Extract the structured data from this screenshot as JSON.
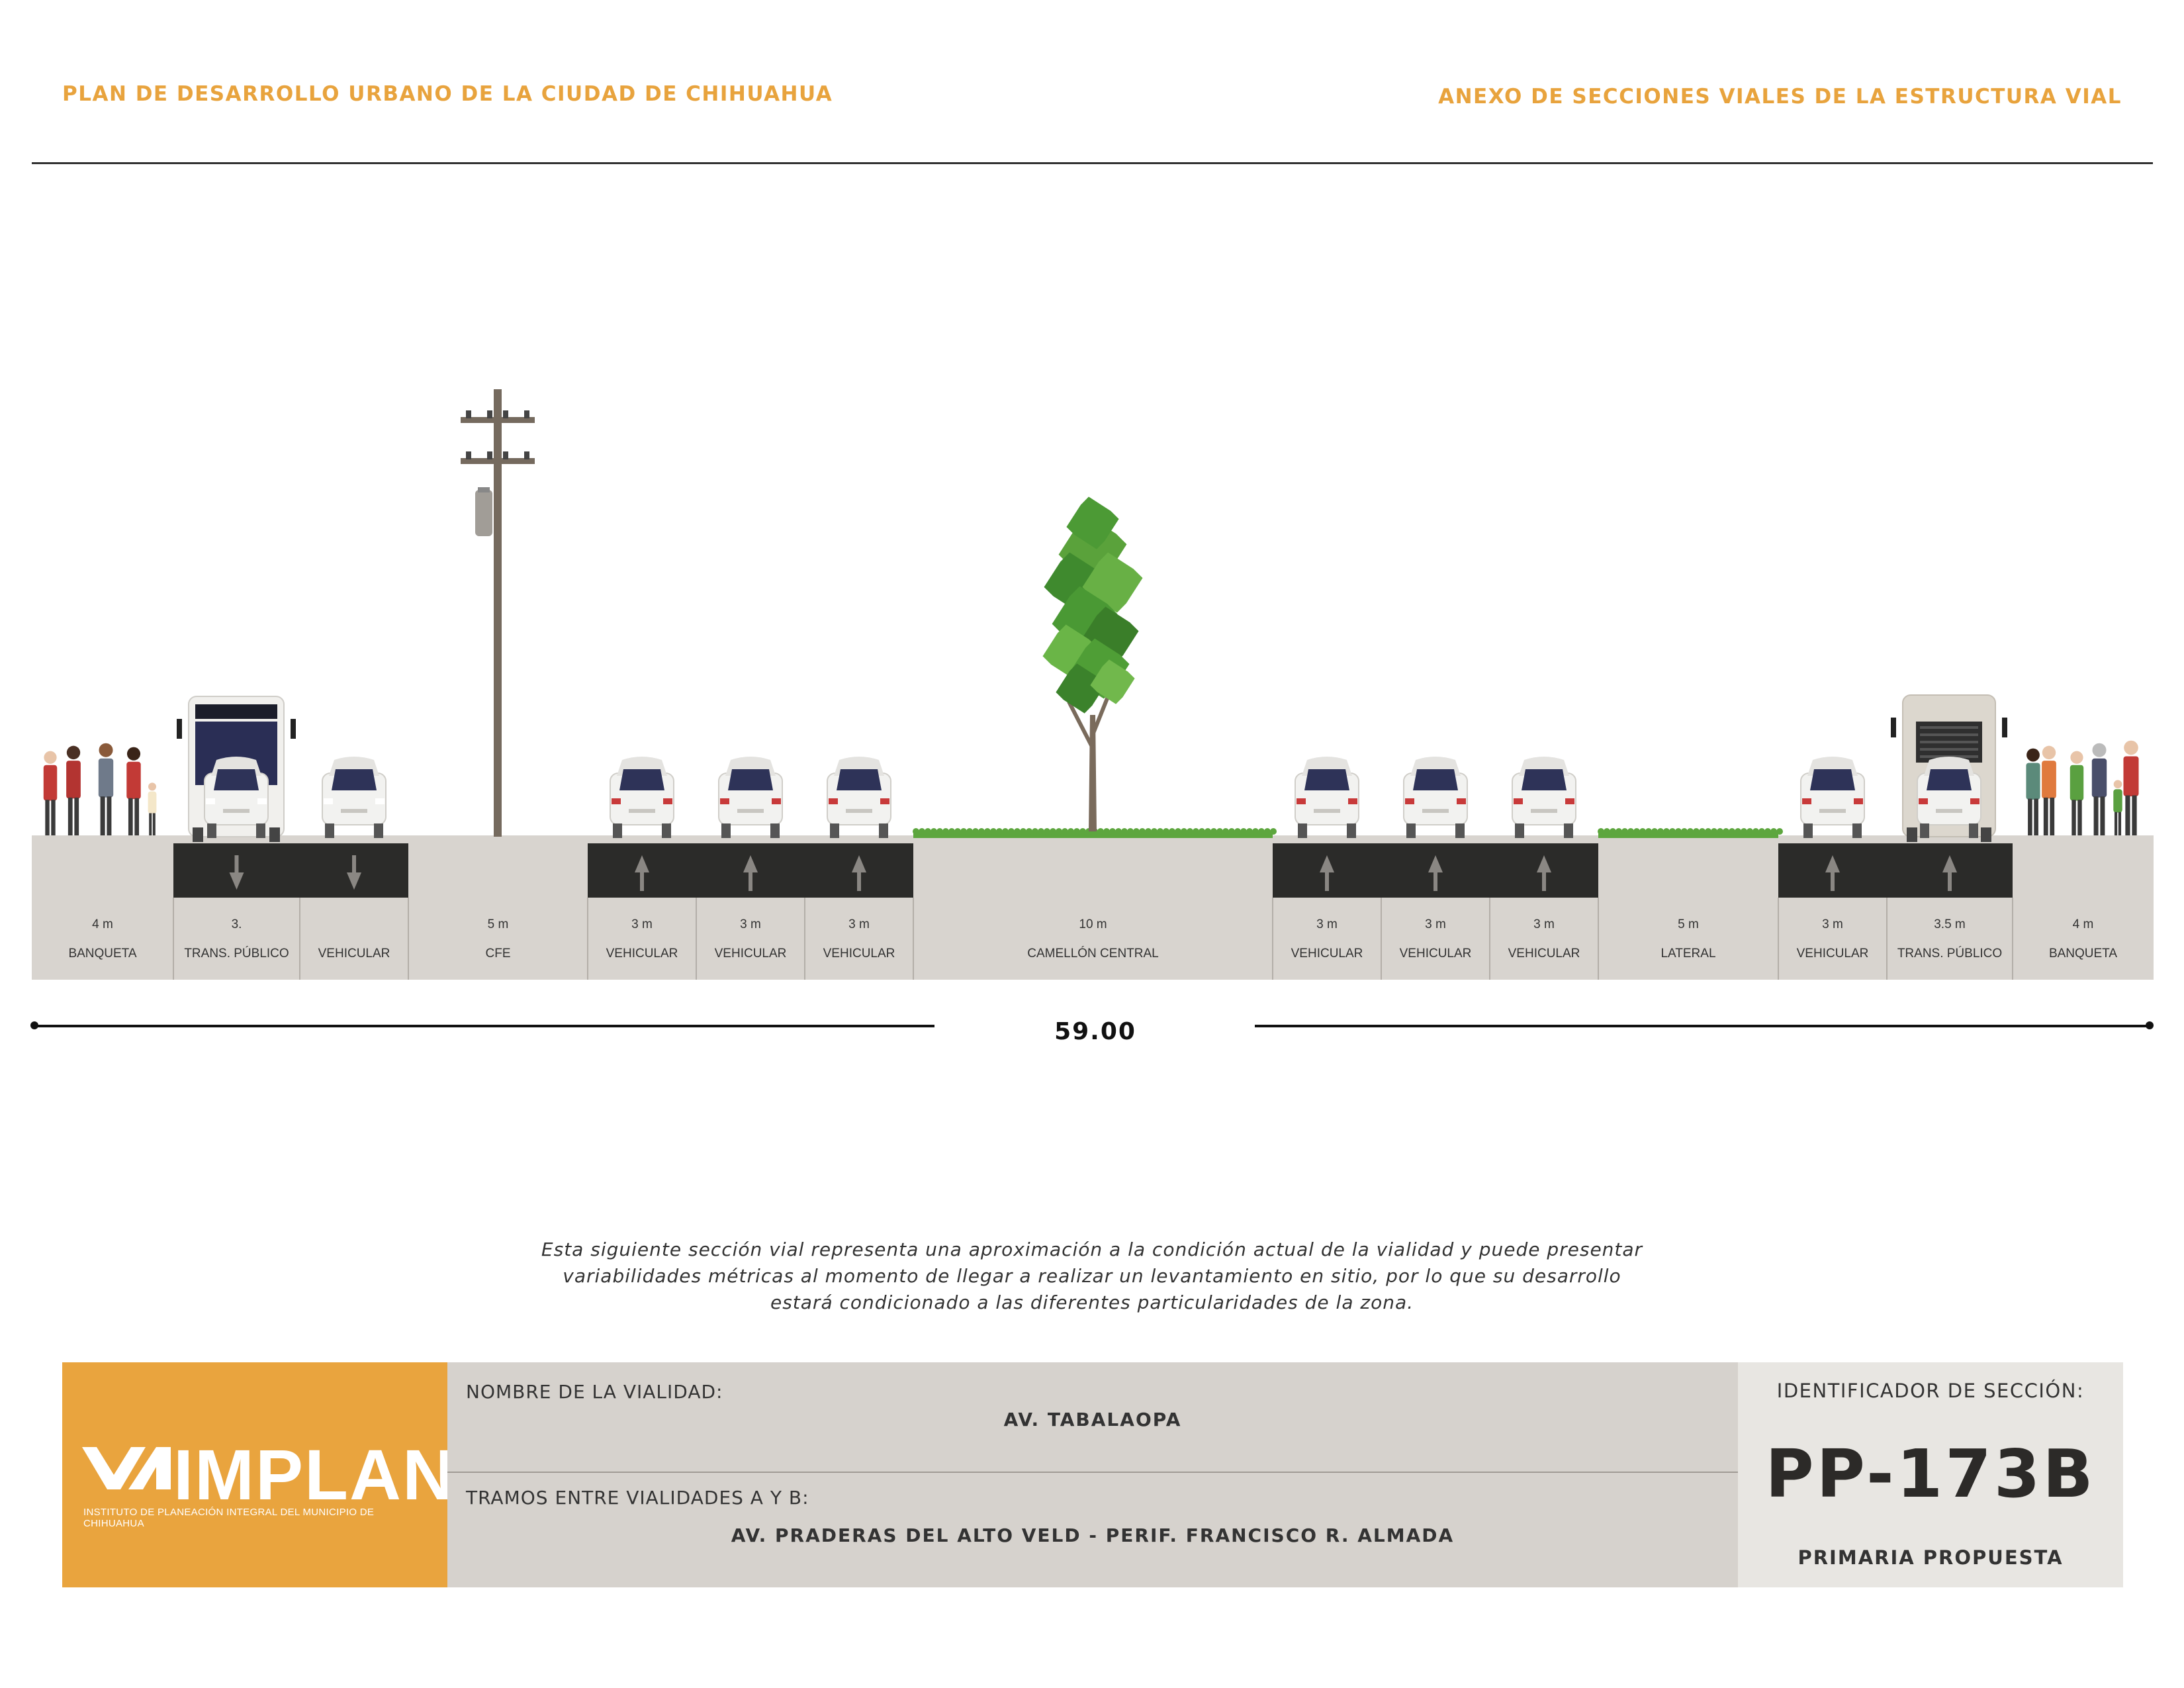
{
  "header": {
    "left_title": "PLAN DE DESARROLLO URBANO DE LA CIUDAD DE CHIHUAHUA",
    "right_title": "ANEXO DE SECCIONES VIALES DE LA ESTRUCTURA VIAL"
  },
  "section": {
    "total_width": "59.00",
    "segments": [
      {
        "width": "4 m",
        "label": "BANQUETA",
        "kind": "sidewalk"
      },
      {
        "width": "3.",
        "label": "TRANS. PÚBLICO",
        "kind": "lane",
        "direction": "down"
      },
      {
        "width": "",
        "label": "VEHICULAR",
        "kind": "lane",
        "direction": "down"
      },
      {
        "width": "5 m",
        "label": "CFE",
        "kind": "utility"
      },
      {
        "width": "3 m",
        "label": "VEHICULAR",
        "kind": "lane",
        "direction": "up"
      },
      {
        "width": "3 m",
        "label": "VEHICULAR",
        "kind": "lane",
        "direction": "up"
      },
      {
        "width": "3 m",
        "label": "VEHICULAR",
        "kind": "lane",
        "direction": "up"
      },
      {
        "width": "10 m",
        "label": "CAMELLÓN CENTRAL",
        "kind": "median"
      },
      {
        "width": "3 m",
        "label": "VEHICULAR",
        "kind": "lane",
        "direction": "up"
      },
      {
        "width": "3 m",
        "label": "VEHICULAR",
        "kind": "lane",
        "direction": "up"
      },
      {
        "width": "3 m",
        "label": "VEHICULAR",
        "kind": "lane",
        "direction": "up"
      },
      {
        "width": "5 m",
        "label": "LATERAL",
        "kind": "median"
      },
      {
        "width": "3 m",
        "label": "VEHICULAR",
        "kind": "lane",
        "direction": "up"
      },
      {
        "width": "3.5 m",
        "label": "TRANS. PÚBLICO",
        "kind": "lane",
        "direction": "up"
      },
      {
        "width": "4 m",
        "label": "BANQUETA",
        "kind": "sidewalk"
      }
    ],
    "colors": {
      "pavement": "#2b2b29",
      "sidewalk": "#d8d4cf",
      "grass": "#5da63e",
      "accent": "#e9a43e"
    }
  },
  "note": "Esta siguiente sección vial representa una aproximación a la condición actual de la vialidad y puede presentar variabilidades métricas al momento de llegar a realizar un levantamiento en sitio, por lo que su desarrollo estará condicionado a las diferentes particularidades de la zona.",
  "footer": {
    "logo_text": "IMPLAN",
    "logo_subtitle": "INSTITUTO DE PLANEACIÓN INTEGRAL DEL MUNICIPIO DE CHIHUAHUA",
    "road_name_label": "NOMBRE DE LA VIALIDAD:",
    "road_name": "AV. TABALAOPA",
    "stretch_label": "TRAMOS ENTRE VIALIDADES A Y B:",
    "stretch": "AV. PRADERAS DEL ALTO VELD - PERIF. FRANCISCO R. ALMADA",
    "id_label": "IDENTIFICADOR DE SECCIÓN:",
    "id_code": "PP-173B",
    "classification": "PRIMARIA PROPUESTA"
  }
}
